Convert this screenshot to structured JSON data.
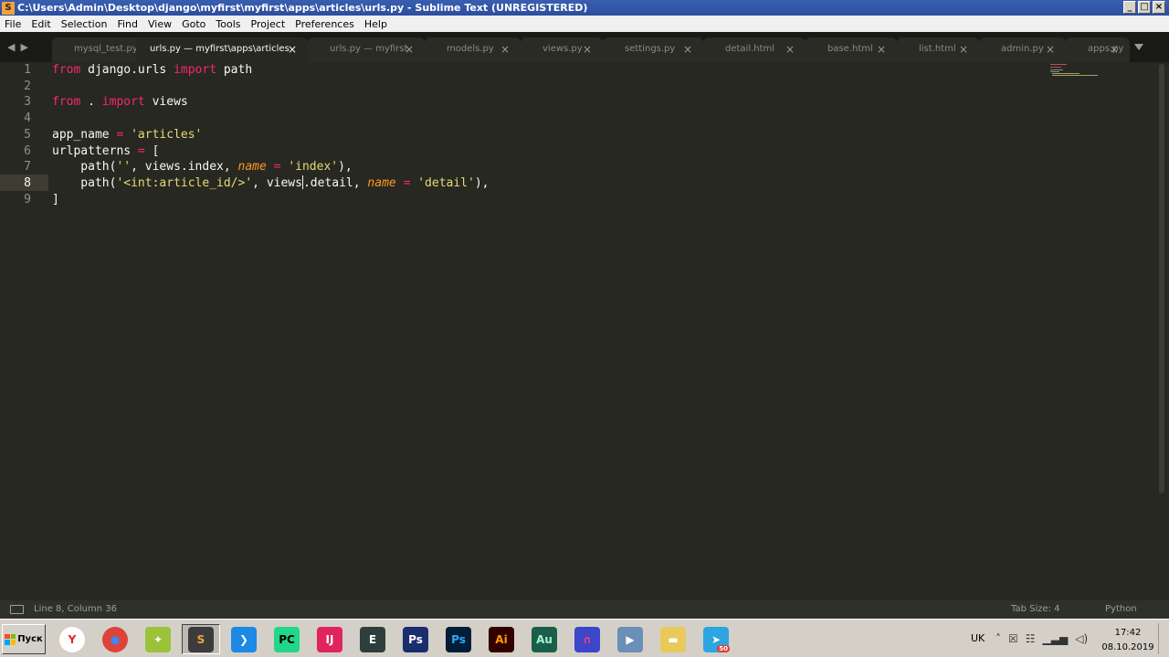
{
  "window": {
    "title": "C:\\Users\\Admin\\Desktop\\django\\myfirst\\myfirst\\apps\\articles\\urls.py - Sublime Text (UNREGISTERED)",
    "buttons": [
      "_",
      "□",
      "×"
    ]
  },
  "menu": [
    "File",
    "Edit",
    "Selection",
    "Find",
    "View",
    "Goto",
    "Tools",
    "Project",
    "Preferences",
    "Help"
  ],
  "tabs": [
    {
      "label": "mysql_test.py",
      "active": false
    },
    {
      "label": "urls.py — myfirst\\apps\\articles",
      "active": true
    },
    {
      "label": "urls.py — myfirst",
      "active": false
    },
    {
      "label": "models.py",
      "active": false
    },
    {
      "label": "views.py",
      "active": false
    },
    {
      "label": "settings.py",
      "active": false
    },
    {
      "label": "detail.html",
      "active": false
    },
    {
      "label": "base.html",
      "active": false
    },
    {
      "label": "list.html",
      "active": false
    },
    {
      "label": "admin.py",
      "active": false
    },
    {
      "label": "apps.py",
      "active": false
    }
  ],
  "tab_close_glyph": "×",
  "tab_nav": [
    "◀",
    "▶"
  ],
  "editor": {
    "line_numbers": [
      "1",
      "2",
      "3",
      "4",
      "5",
      "6",
      "7",
      "8",
      "9"
    ],
    "current_line": 8,
    "code": [
      [
        {
          "t": "from",
          "c": "kw"
        },
        {
          "t": " django.urls "
        },
        {
          "t": "import",
          "c": "kw"
        },
        {
          "t": " path"
        }
      ],
      [],
      [
        {
          "t": "from",
          "c": "kw"
        },
        {
          "t": " . "
        },
        {
          "t": "import",
          "c": "kw"
        },
        {
          "t": " views"
        }
      ],
      [],
      [
        {
          "t": "app_name "
        },
        {
          "t": "=",
          "c": "kw"
        },
        {
          "t": " "
        },
        {
          "t": "'articles'",
          "c": "str"
        }
      ],
      [
        {
          "t": "urlpatterns "
        },
        {
          "t": "=",
          "c": "kw"
        },
        {
          "t": " ["
        }
      ],
      [
        {
          "t": "    path("
        },
        {
          "t": "''",
          "c": "str"
        },
        {
          "t": ", views.index, "
        },
        {
          "t": "name",
          "c": "param"
        },
        {
          "t": " "
        },
        {
          "t": "=",
          "c": "kw"
        },
        {
          "t": " "
        },
        {
          "t": "'index'",
          "c": "str"
        },
        {
          "t": "),"
        }
      ],
      [
        {
          "t": "    path("
        },
        {
          "t": "'<int:article_id/>'",
          "c": "str"
        },
        {
          "t": ", views"
        },
        {
          "t": "",
          "c": "cursor"
        },
        {
          "t": ".detail, "
        },
        {
          "t": "name",
          "c": "param"
        },
        {
          "t": " "
        },
        {
          "t": "=",
          "c": "kw"
        },
        {
          "t": " "
        },
        {
          "t": "'detail'",
          "c": "str"
        },
        {
          "t": "),"
        }
      ],
      [
        {
          "t": "]"
        }
      ]
    ]
  },
  "status": {
    "position": "Line 8, Column 36",
    "tab_size": "Tab Size: 4",
    "syntax": "Python"
  },
  "taskbar": {
    "start_label": "Пуск",
    "apps": [
      {
        "icon": "yandex-browser-icon",
        "glyph": "Y",
        "bg": "#ffffff",
        "fg": "#e52620"
      },
      {
        "icon": "chrome-icon",
        "glyph": "●",
        "bg": "#db4437",
        "fg": "#4285f4"
      },
      {
        "icon": "lime-app-icon",
        "glyph": "✦",
        "bg": "#9cc23a",
        "fg": "#ffffff"
      },
      {
        "icon": "sublime-text-icon",
        "glyph": "S",
        "bg": "#3c3c3c",
        "fg": "#f2a33a"
      },
      {
        "icon": "vscode-icon",
        "glyph": "❯",
        "bg": "#1e88e5",
        "fg": "#ffffff"
      },
      {
        "icon": "pycharm-icon",
        "glyph": "PC",
        "bg": "#21d789",
        "fg": "#000000"
      },
      {
        "icon": "intellij-icon",
        "glyph": "IJ",
        "bg": "#e0245e",
        "fg": "#ffffff"
      },
      {
        "icon": "eclipse-text-icon",
        "glyph": "E",
        "bg": "#2d3e3d",
        "fg": "#ffffff"
      },
      {
        "icon": "photoshop-icon-dark",
        "glyph": "Ps",
        "bg": "#1a2e6e",
        "fg": "#ffffff"
      },
      {
        "icon": "photoshop-icon",
        "glyph": "Ps",
        "bg": "#001e36",
        "fg": "#31a8ff"
      },
      {
        "icon": "illustrator-icon",
        "glyph": "Ai",
        "bg": "#330000",
        "fg": "#ff9a00"
      },
      {
        "icon": "audition-icon",
        "glyph": "Au",
        "bg": "#1a5f4a",
        "fg": "#9ff5cf"
      },
      {
        "icon": "headphones-icon",
        "glyph": "∩",
        "bg": "#3b46c8",
        "fg": "#f04070"
      },
      {
        "icon": "media-player-icon",
        "glyph": "▶",
        "bg": "#6a8fb8",
        "fg": "#ffffff"
      },
      {
        "icon": "folder-icon",
        "glyph": "▬",
        "bg": "#e8c95a",
        "fg": "#ffffff"
      },
      {
        "icon": "telegram-icon",
        "glyph": "➤",
        "bg": "#2ca5e0",
        "fg": "#ffffff",
        "badge": "50"
      }
    ],
    "language": "UK",
    "tray_icons": [
      "˄",
      "☒",
      "☷",
      "▁▃▅",
      "◁)"
    ],
    "time": "17:42",
    "date": "08.10.2019"
  },
  "colors": {
    "background": "#272822",
    "keyword": "#f92672",
    "string": "#e6db74",
    "parameter": "#fd971f",
    "text": "#f8f8f2"
  }
}
